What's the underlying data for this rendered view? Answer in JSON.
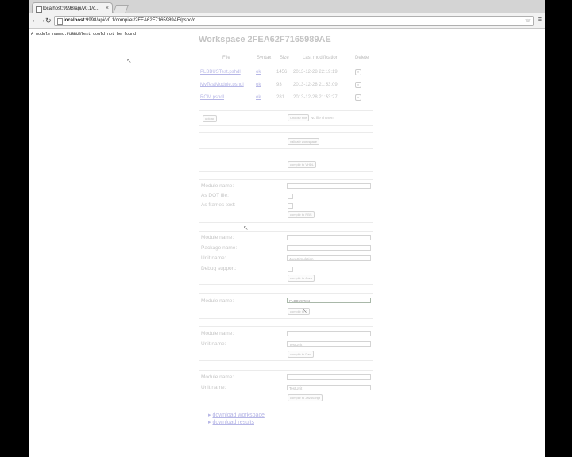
{
  "tab": {
    "title": "localhost:9998/api/v0.1/c..."
  },
  "toolbar": {
    "url_host": "localhost",
    "url_rest": ":9998/api/v0.1/compiler/2FEA62F7165989AE/psoc/c"
  },
  "error_message": "A module named:PLBBUSTest could not be found",
  "workspace": {
    "title": "Workspace 2FEA62F7165989AE",
    "columns": {
      "file": "File",
      "syntax": "Syntax",
      "size": "Size",
      "modified": "Last modification",
      "delete": "Delete"
    },
    "files": [
      {
        "name": "PLBBUSTest.pshdl",
        "syntax": "ok",
        "size": "1456",
        "modified": "2013-12-28 22:19:19"
      },
      {
        "name": "MyTestModule.pshdl",
        "syntax": "ok",
        "size": "93",
        "modified": "2013-12-28 21:53:09"
      },
      {
        "name": "ROM.pshdl",
        "syntax": "ok",
        "size": "281",
        "modified": "2013-12-28 21:53:27"
      }
    ]
  },
  "upload": {
    "button": "upload",
    "choose_file": "Choose File",
    "no_file": "No file chosen"
  },
  "validate": {
    "button": "validate workspace"
  },
  "vhdl": {
    "button": "compile to VHDL"
  },
  "rbs": {
    "module_label": "Module name:",
    "dot_label": "As DOT file:",
    "frames_label": "As frames text:",
    "button": "compile to RBS"
  },
  "java": {
    "module_label": "Module name:",
    "package_label": "Package name:",
    "unit_label": "Unit name:",
    "unit_value": "JavaSimulation",
    "debug_label": "Debug support:",
    "button": "compile to Java"
  },
  "psoc": {
    "module_label": "Module name:",
    "module_value": "PLBBUSTest",
    "button": "compile to C"
  },
  "dart": {
    "module_label": "Module name:",
    "unit_label": "Unit name:",
    "unit_value": "TestUnit",
    "button": "compile to Dart"
  },
  "js": {
    "module_label": "Module name:",
    "unit_label": "Unit name:",
    "unit_value": "TestUnit",
    "button": "compile to JavaScript"
  },
  "links": {
    "download_workspace": "download workspace",
    "download_results": "download results"
  }
}
